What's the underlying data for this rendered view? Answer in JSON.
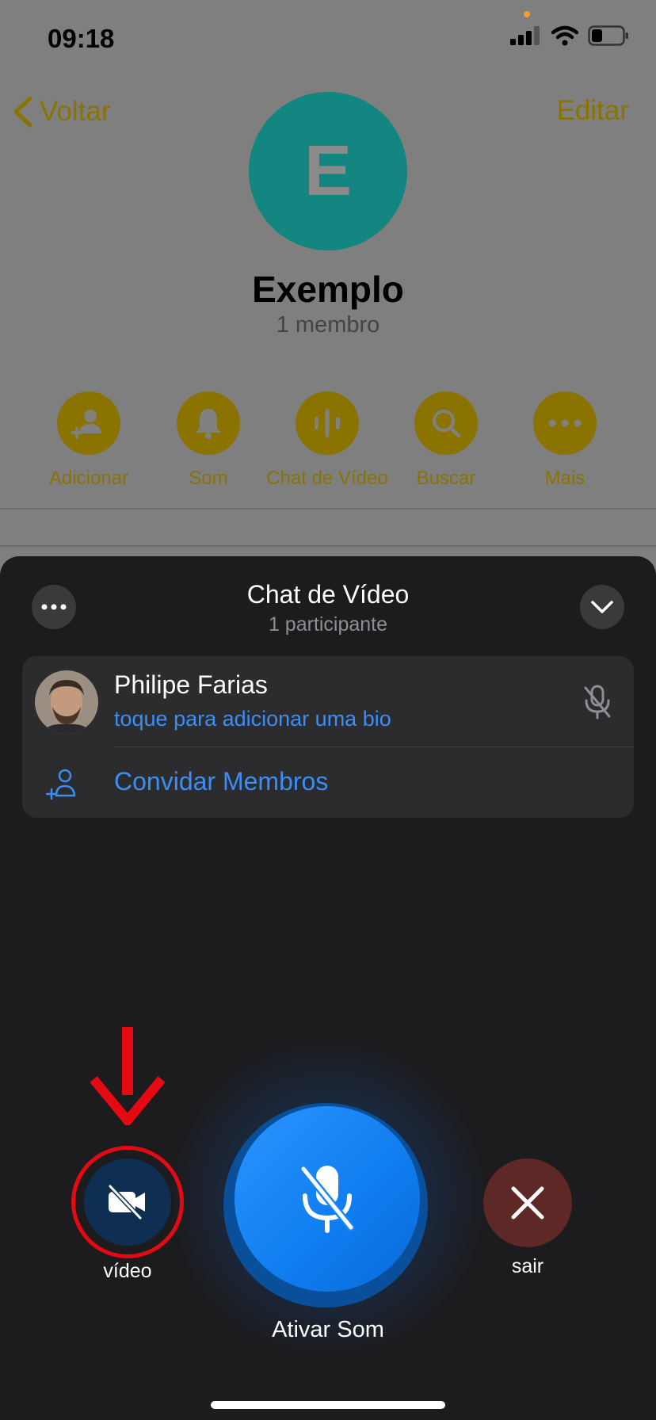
{
  "status_bar": {
    "time": "09:18"
  },
  "nav": {
    "back_label": "Voltar",
    "edit_label": "Editar"
  },
  "profile": {
    "avatar_letter": "E",
    "name": "Exemplo",
    "subtitle": "1 membro"
  },
  "actions": [
    {
      "label": "Adicionar",
      "icon": "add-person-icon"
    },
    {
      "label": "Som",
      "icon": "bell-icon"
    },
    {
      "label": "Chat de Vídeo",
      "icon": "voice-wave-icon"
    },
    {
      "label": "Buscar",
      "icon": "search-icon"
    },
    {
      "label": "Mais",
      "icon": "more-icon"
    }
  ],
  "sheet": {
    "title": "Chat de Vídeo",
    "subtitle": "1 participante",
    "participant": {
      "name": "Philipe Farias",
      "bio": "toque para adicionar uma bio",
      "mic_state": "muted"
    },
    "invite_label": "Convidar Membros"
  },
  "controls": {
    "video_label": "vídeo",
    "mic_label": "Ativar Som",
    "leave_label": "sair"
  },
  "colors": {
    "accent_blue": "#3a8ef6",
    "gold": "#8a7300",
    "highlight_red": "#e50914",
    "leave_red": "#5e2826"
  }
}
